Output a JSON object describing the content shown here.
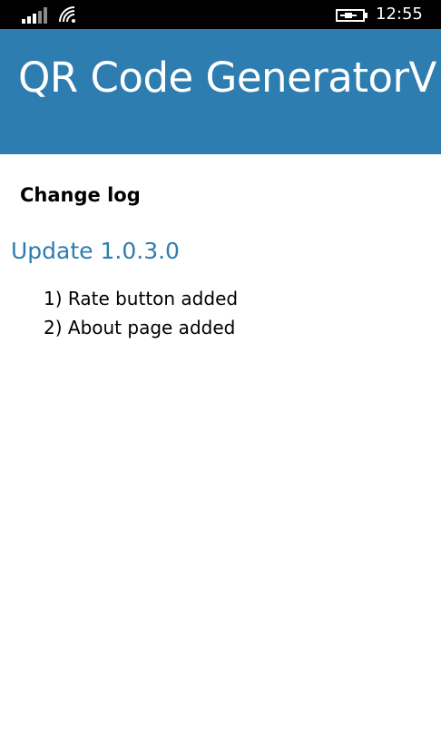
{
  "status_bar": {
    "time": "12:55",
    "icons": [
      "signal-icon",
      "wifi-icon",
      "battery-charging-icon"
    ]
  },
  "header": {
    "title": "QR Code GeneratorV"
  },
  "changelog": {
    "heading": "Change log",
    "update_title": "Update 1.0.3.0",
    "items": [
      "1) Rate button added",
      "2) About page added"
    ]
  },
  "colors": {
    "accent": "#2e7db0",
    "status_bar": "#000000",
    "background": "#ffffff"
  }
}
